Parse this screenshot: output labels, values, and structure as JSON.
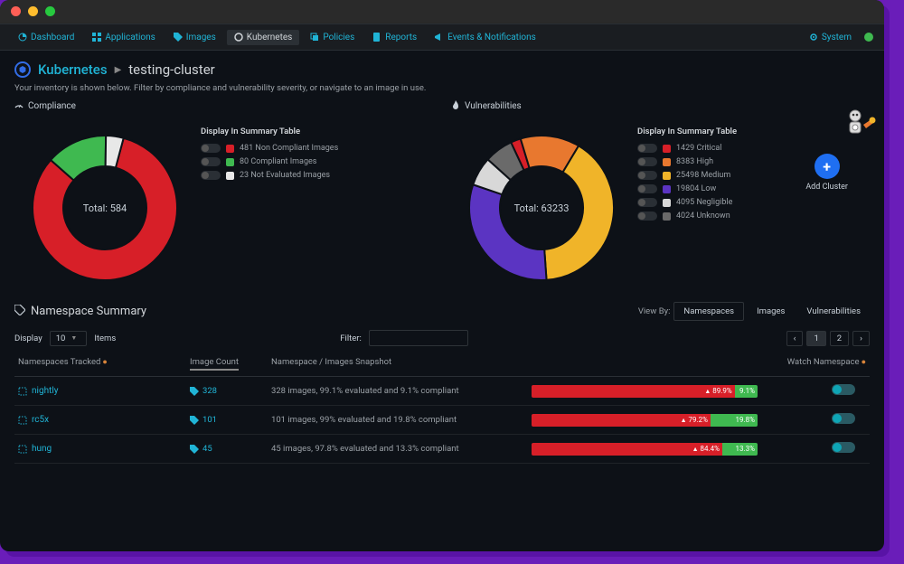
{
  "nav": {
    "items": [
      {
        "icon": "dashboard",
        "label": "Dashboard"
      },
      {
        "icon": "grid",
        "label": "Applications"
      },
      {
        "icon": "tag",
        "label": "Images"
      },
      {
        "icon": "k8s",
        "label": "Kubernetes"
      },
      {
        "icon": "copy",
        "label": "Policies"
      },
      {
        "icon": "file",
        "label": "Reports"
      },
      {
        "icon": "bell",
        "label": "Events & Notifications"
      }
    ],
    "system_label": "System"
  },
  "breadcrumb": {
    "root": "Kubernetes",
    "current": "testing-cluster"
  },
  "subdesc": "Your inventory is shown below. Filter by compliance and vulnerability severity, or navigate to an image in use.",
  "add_cluster": "Add Cluster",
  "compliance": {
    "title": "Compliance",
    "total_label": "Total: 584",
    "legend_title": "Display In Summary Table",
    "items": [
      {
        "color": "#d71f28",
        "label": "481 Non Compliant Images"
      },
      {
        "color": "#3fb950",
        "label": "80 Compliant Images"
      },
      {
        "color": "#e8e8e8",
        "label": "23 Not Evaluated Images"
      }
    ]
  },
  "vulnerabilities": {
    "title": "Vulnerabilities",
    "total_label": "Total: 63233",
    "legend_title": "Display In Summary Table",
    "items": [
      {
        "color": "#d71f28",
        "label": "1429 Critical"
      },
      {
        "color": "#e8782f",
        "label": "8383 High"
      },
      {
        "color": "#f0b429",
        "label": "25498 Medium"
      },
      {
        "color": "#5b34c2",
        "label": "19804 Low"
      },
      {
        "color": "#d8d8d8",
        "label": "4095 Negligible"
      },
      {
        "color": "#6a6a6a",
        "label": "4024 Unknown"
      }
    ]
  },
  "chart_data": [
    {
      "type": "pie",
      "title": "Compliance",
      "total": 584,
      "series": [
        {
          "name": "Non Compliant",
          "value": 481,
          "color": "#d71f28"
        },
        {
          "name": "Compliant",
          "value": 80,
          "color": "#3fb950"
        },
        {
          "name": "Not Evaluated",
          "value": 23,
          "color": "#e8e8e8"
        }
      ]
    },
    {
      "type": "pie",
      "title": "Vulnerabilities",
      "total": 63233,
      "series": [
        {
          "name": "Critical",
          "value": 1429,
          "color": "#d71f28"
        },
        {
          "name": "High",
          "value": 8383,
          "color": "#e8782f"
        },
        {
          "name": "Medium",
          "value": 25498,
          "color": "#f0b429"
        },
        {
          "name": "Low",
          "value": 19804,
          "color": "#5b34c2"
        },
        {
          "name": "Negligible",
          "value": 4095,
          "color": "#d8d8d8"
        },
        {
          "name": "Unknown",
          "value": 4024,
          "color": "#6a6a6a"
        }
      ]
    }
  ],
  "ns": {
    "title": "Namespace Summary",
    "view_by_label": "View By:",
    "view_options": [
      "Namespaces",
      "Images",
      "Vulnerabilities"
    ],
    "display_label": "Display",
    "display_value": "10",
    "items_label": "Items",
    "filter_label": "Filter:",
    "pages": [
      "1",
      "2"
    ],
    "columns": {
      "ns": "Namespaces Tracked",
      "ic": "Image Count",
      "snap": "Namespace / Images Snapshot",
      "watch": "Watch Namespace"
    },
    "rows": [
      {
        "name": "nightly",
        "count": "328",
        "snapshot": "328 images, 99.1% evaluated and 9.1% compliant",
        "red_pct": 89.9,
        "red_label": "89.9%",
        "grn_label": "9.1%"
      },
      {
        "name": "rc5x",
        "count": "101",
        "snapshot": "101 images, 99% evaluated and 19.8% compliant",
        "red_pct": 79.2,
        "red_label": "79.2%",
        "grn_label": "19.8%"
      },
      {
        "name": "hung",
        "count": "45",
        "snapshot": "45 images, 97.8% evaluated and 13.3% compliant",
        "red_pct": 84.4,
        "red_label": "84.4%",
        "grn_label": "13.3%"
      }
    ]
  }
}
